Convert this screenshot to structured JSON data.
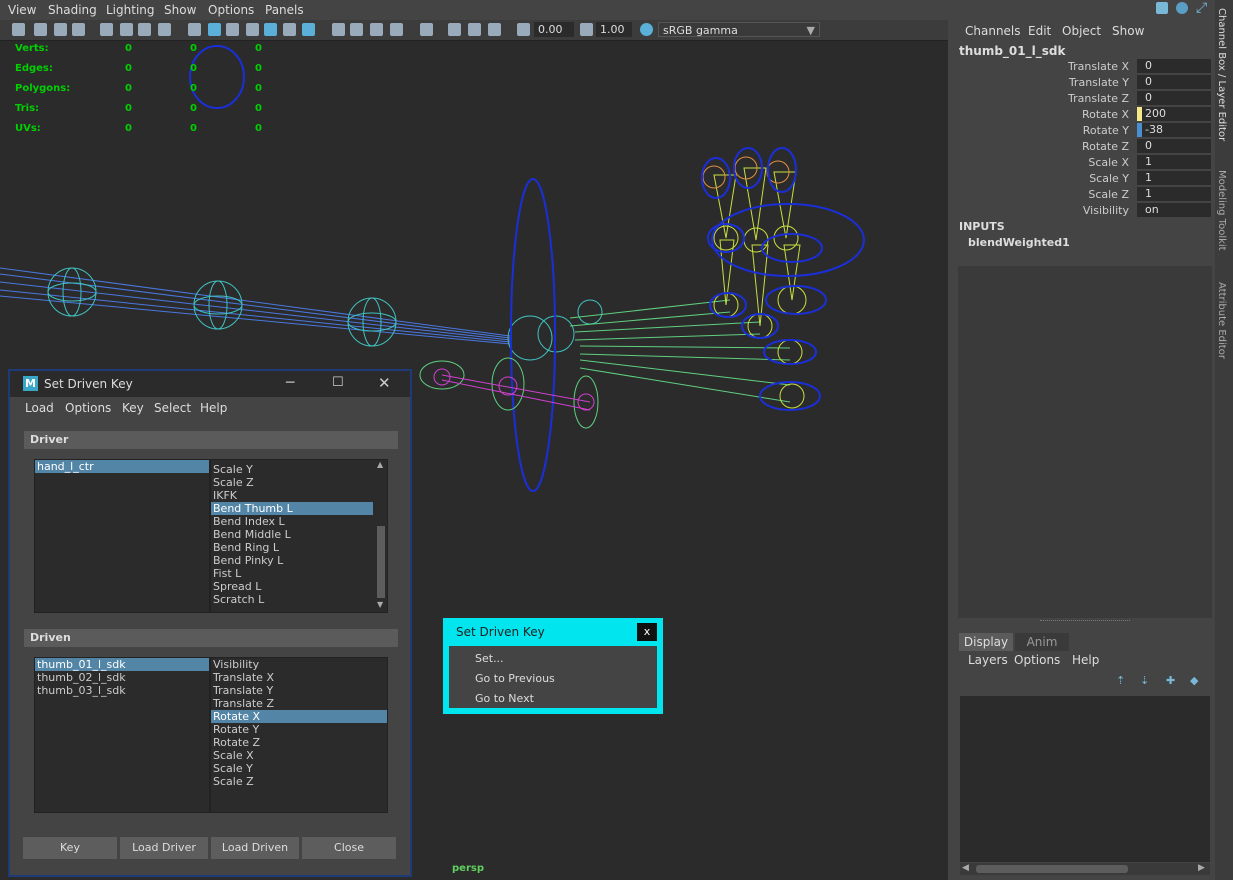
{
  "viewport": {
    "menu": [
      "View",
      "Shading",
      "Lighting",
      "Show",
      "Options",
      "Panels"
    ],
    "toolbar": {
      "exposure": "0.00",
      "gamma": "1.00",
      "colorspace": "sRGB gamma"
    },
    "hud": {
      "rows": [
        {
          "label": "Verts:",
          "v1": "0",
          "v2": "0",
          "v3": "0"
        },
        {
          "label": "Edges:",
          "v1": "0",
          "v2": "0",
          "v3": "0"
        },
        {
          "label": "Polygons:",
          "v1": "0",
          "v2": "0",
          "v3": "0"
        },
        {
          "label": "Tris:",
          "v1": "0",
          "v2": "0",
          "v3": "0"
        },
        {
          "label": "UVs:",
          "v1": "0",
          "v2": "0",
          "v3": "0"
        }
      ]
    },
    "camera": "persp"
  },
  "sdk_window": {
    "title": "Set Driven Key",
    "menu": [
      "Load",
      "Options",
      "Key",
      "Select",
      "Help"
    ],
    "driver_label": "Driver",
    "driver_objects": [
      "hand_l_ctr"
    ],
    "driver_attrs": [
      "Scale Y",
      "Scale Z",
      "IKFK",
      "Bend Thumb L",
      "Bend Index L",
      "Bend Middle L",
      "Bend Ring L",
      "Bend Pinky L",
      "Fist L",
      "Spread L",
      "Scratch L"
    ],
    "driven_label": "Driven",
    "driven_objects": [
      "thumb_01_l_sdk",
      "thumb_02_l_sdk",
      "thumb_03_l_sdk"
    ],
    "driven_attrs": [
      "Visibility",
      "Translate X",
      "Translate Y",
      "Translate Z",
      "Rotate X",
      "Rotate Y",
      "Rotate Z",
      "Scale X",
      "Scale Y",
      "Scale Z"
    ],
    "buttons": {
      "key": "Key",
      "load_driver": "Load Driver",
      "load_driven": "Load Driven",
      "close": "Close"
    }
  },
  "popup": {
    "title": "Set Driven Key",
    "close": "x",
    "items": [
      "Set...",
      "Go to Previous",
      "Go to Next"
    ]
  },
  "channel_box": {
    "menu": [
      "Channels",
      "Edit",
      "Object",
      "Show"
    ],
    "object": "thumb_01_l_sdk",
    "channels": [
      {
        "name": "Translate X",
        "value": "0"
      },
      {
        "name": "Translate Y",
        "value": "0"
      },
      {
        "name": "Translate Z",
        "value": "0"
      },
      {
        "name": "Rotate X",
        "value": "200"
      },
      {
        "name": "Rotate Y",
        "value": "-38"
      },
      {
        "name": "Rotate Z",
        "value": "0"
      },
      {
        "name": "Scale X",
        "value": "1"
      },
      {
        "name": "Scale Y",
        "value": "1"
      },
      {
        "name": "Scale Z",
        "value": "1"
      },
      {
        "name": "Visibility",
        "value": "on"
      }
    ],
    "inputs_label": "INPUTS",
    "input_node": "blendWeighted1"
  },
  "layer_editor": {
    "tabs": [
      "Display",
      "Anim"
    ],
    "menu": [
      "Layers",
      "Options",
      "Help"
    ]
  },
  "side_tabs": [
    "Channel Box / Layer Editor",
    "Modeling Toolkit",
    "Attribute Editor"
  ],
  "colors": {
    "sdk_border": "#1e3a78",
    "popup": "#00e5ee",
    "selection": "#5285a6",
    "hud": "#00d000"
  }
}
